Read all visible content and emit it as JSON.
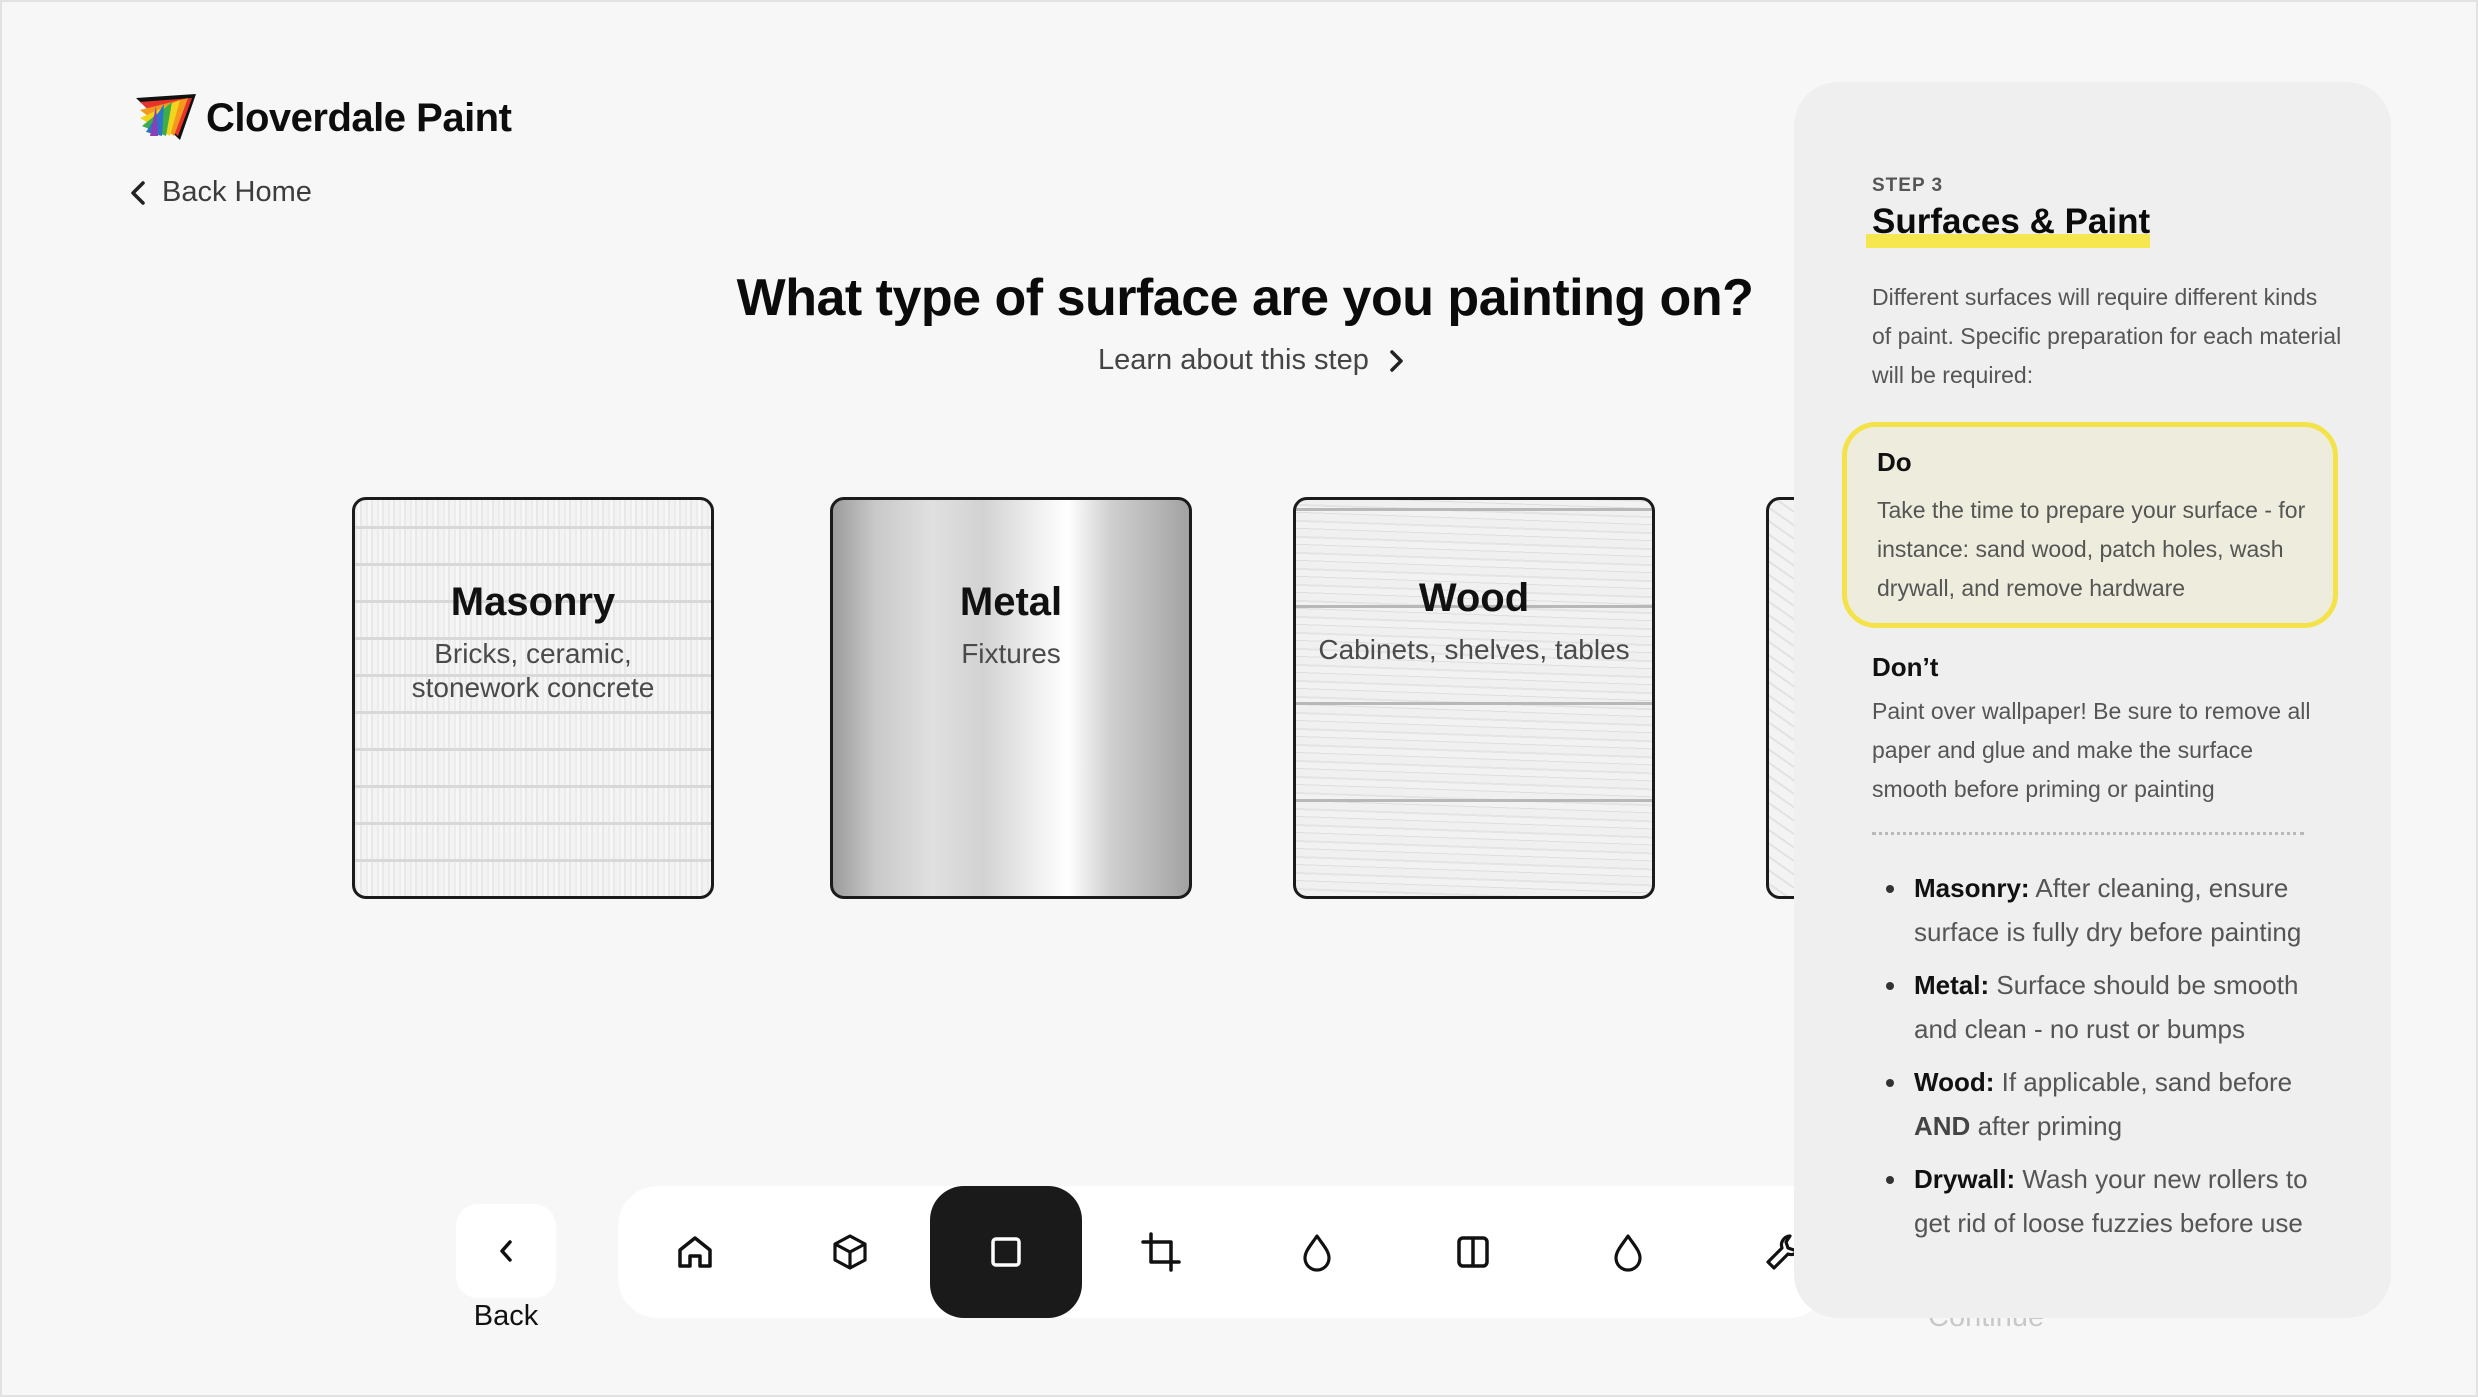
{
  "brand": {
    "name": "Cloverdale Paint"
  },
  "nav": {
    "back_home": "Back Home"
  },
  "question": {
    "title": "What type of surface are you painting on?",
    "learn_link": "Learn about this step"
  },
  "surfaces": [
    {
      "title": "Masonry",
      "subtitle": "Bricks, ceramic, stonework concrete"
    },
    {
      "title": "Metal",
      "subtitle": "Fixtures"
    },
    {
      "title": "Wood",
      "subtitle": "Cabinets, shelves, tables"
    }
  ],
  "toolbar": {
    "back_label": "Back",
    "continue_label": "Continue",
    "items": [
      {
        "icon": "home-icon"
      },
      {
        "icon": "cube-icon"
      },
      {
        "icon": "square-icon",
        "active": true
      },
      {
        "icon": "crop-icon"
      },
      {
        "icon": "drop-icon"
      },
      {
        "icon": "columns-icon"
      },
      {
        "icon": "drop-icon"
      },
      {
        "icon": "wrench-icon"
      }
    ]
  },
  "panel": {
    "step": "STEP 3",
    "title": "Surfaces & Paint",
    "description": "Different surfaces will require different kinds of paint. Specific preparation for each material will be required:",
    "do_title": "Do",
    "do_text": "Take the time to prepare your surface - for instance: sand wood, patch holes, wash drywall, and remove hardware",
    "dont_title": "Don’t",
    "dont_text": "Paint over wallpaper! Be sure to remove all paper and glue and make the surface smooth before priming or painting",
    "tips": [
      {
        "label": "Masonry:",
        "text": "After cleaning, ensure surface is fully dry before painting"
      },
      {
        "label": "Metal:",
        "text": "Surface should be smooth and clean - no rust or bumps"
      },
      {
        "label": "Wood:",
        "text": "If applicable, sand before",
        "emphasis": "AND",
        "text_after": "after priming"
      },
      {
        "label": "Drywall:",
        "text": "Wash your new rollers to get rid of loose fuzzies before use"
      }
    ]
  },
  "colors": {
    "background": "#f7f7f7",
    "highlight": "#f4e24b",
    "active_tool": "#1a1a1a"
  }
}
